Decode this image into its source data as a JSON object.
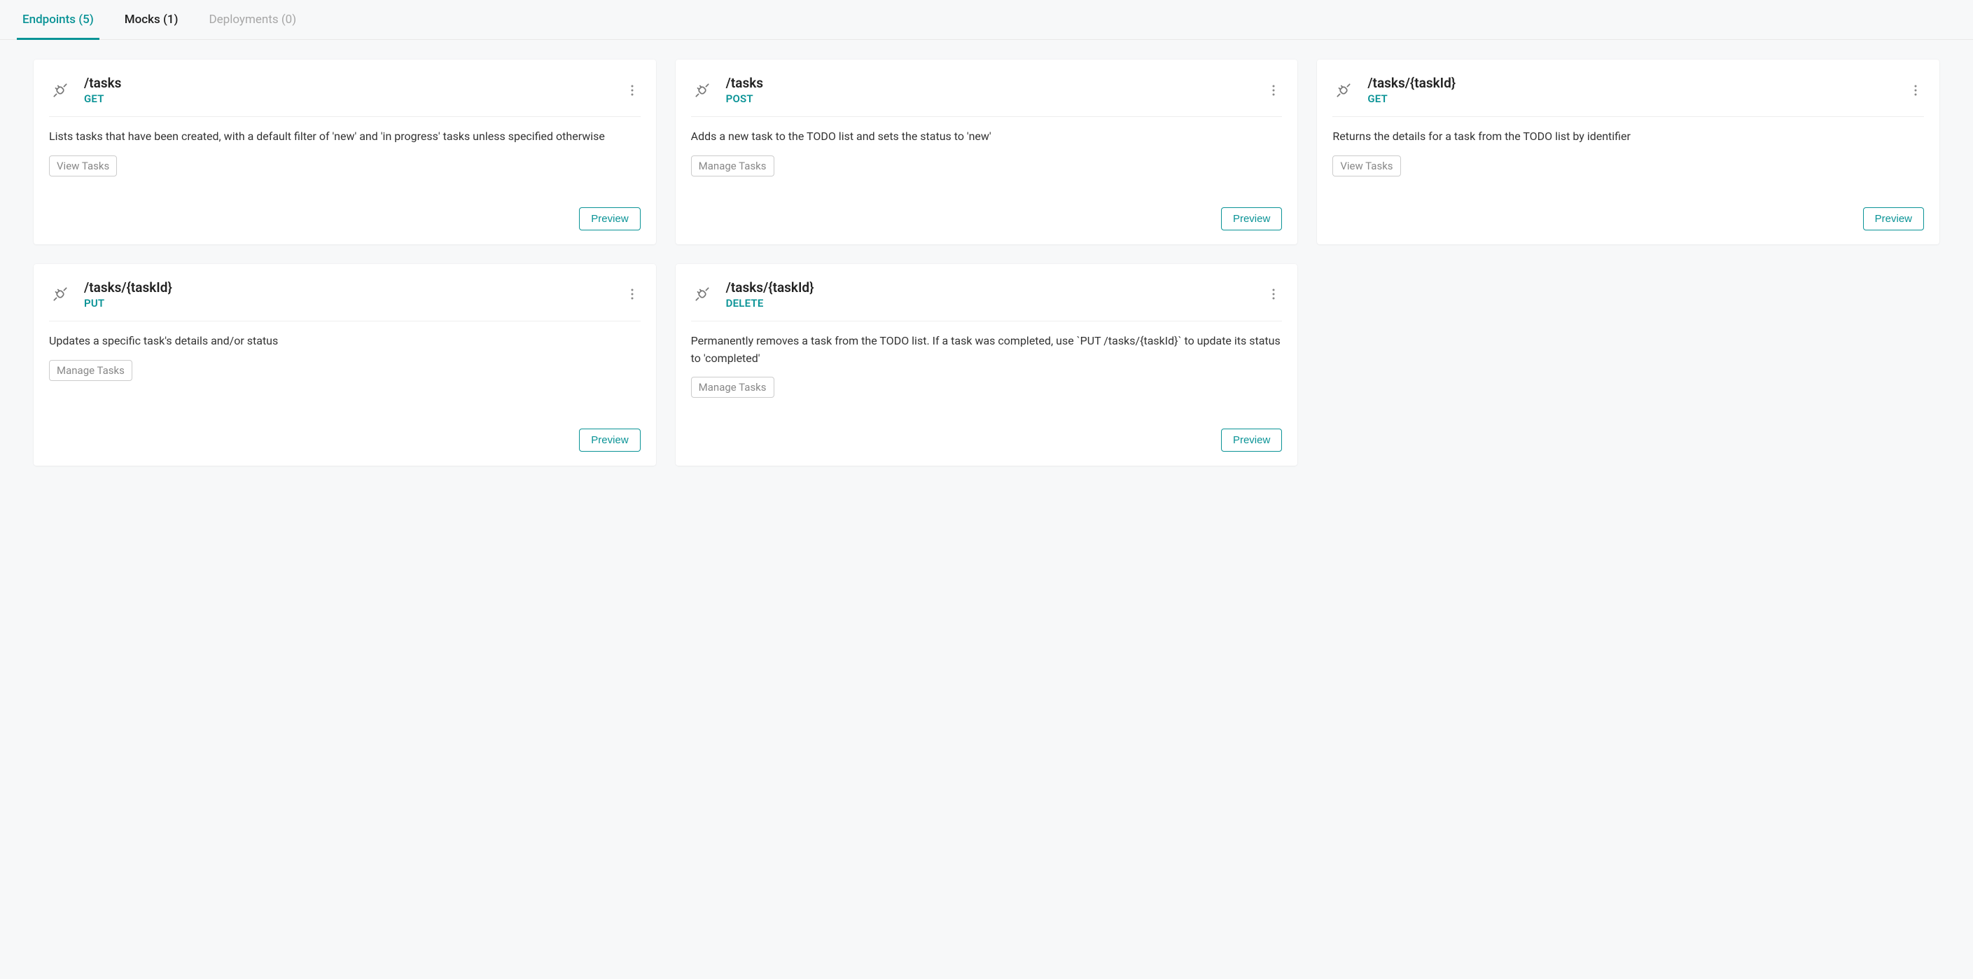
{
  "tabs": [
    {
      "label": "Endpoints (5)",
      "active": true,
      "muted": false
    },
    {
      "label": "Mocks (1)",
      "active": false,
      "muted": false
    },
    {
      "label": "Deployments (0)",
      "active": false,
      "muted": true
    }
  ],
  "preview_label": "Preview",
  "endpoints": [
    {
      "path": "/tasks",
      "method": "GET",
      "description": "Lists tasks that have been created, with a default filter of 'new' and 'in progress' tasks unless specified otherwise",
      "tag": "View Tasks"
    },
    {
      "path": "/tasks",
      "method": "POST",
      "description": "Adds a new task to the TODO list and sets the status to 'new'",
      "tag": "Manage Tasks"
    },
    {
      "path": "/tasks/{taskId}",
      "method": "GET",
      "description": "Returns the details for a task from the TODO list by identifier",
      "tag": "View Tasks"
    },
    {
      "path": "/tasks/{taskId}",
      "method": "PUT",
      "description": "Updates a specific task's details and/or status",
      "tag": "Manage Tasks"
    },
    {
      "path": "/tasks/{taskId}",
      "method": "DELETE",
      "description": "Permanently removes a task from the TODO list. If a task was completed, use `PUT /tasks/{taskId}` to update its status to 'completed'",
      "tag": "Manage Tasks"
    }
  ]
}
